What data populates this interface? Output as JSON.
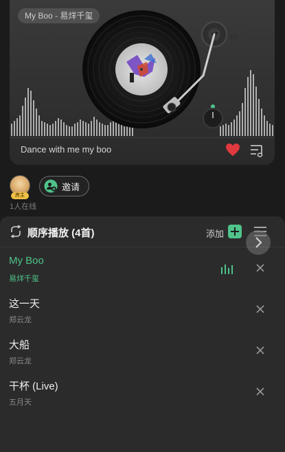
{
  "player": {
    "now_playing_pill": "My Boo - 易烊千玺",
    "song_line": "Dance with me my boo",
    "liked": true
  },
  "listeners": {
    "avatar_tag": "房主",
    "invite_label": "邀请",
    "online_text": "1人在线"
  },
  "queue": {
    "mode_label": "顺序播放 (4首)",
    "add_label": "添加",
    "tracks": [
      {
        "title": "My Boo",
        "artist": "易烊千玺",
        "active": true
      },
      {
        "title": "这一天",
        "artist": "郑云龙",
        "active": false
      },
      {
        "title": "大船",
        "artist": "郑云龙",
        "active": false
      },
      {
        "title": "干杯 (Live)",
        "artist": "五月天",
        "active": false
      }
    ]
  },
  "colors": {
    "accent": "#4fc38a",
    "heart": "#e0393e",
    "background": "#1b1b1b"
  }
}
